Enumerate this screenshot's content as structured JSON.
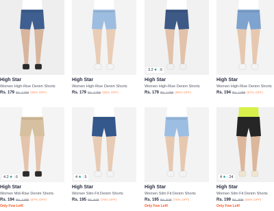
{
  "products": [
    {
      "brand": "High Star",
      "title": "Women High-Rise Denim Shorts",
      "price": "Rs. 179",
      "mrp": "Rs. 1799",
      "discount": "(90% OFF)",
      "rating": "",
      "rating_count": "",
      "stock": "",
      "skin": "#d8b59d",
      "shorts": "#3e5f8f",
      "shoe": "#2a2a2a",
      "bg": "#eeeeee"
    },
    {
      "brand": "High Star",
      "title": "Women High-Rise Denim Shorts",
      "price": "Rs. 179",
      "mrp": "Rs. 1799",
      "discount": "(90% OFF)",
      "rating": "",
      "rating_count": "",
      "stock": "",
      "skin": "#e9cdb6",
      "shorts": "#9dbde0",
      "shoe": "#f4f4f4",
      "bg": "#f3f3f3"
    },
    {
      "brand": "High Star",
      "title": "Women High-Rise Denim Shorts",
      "price": "Rs. 179",
      "mrp": "Rs. 1799",
      "discount": "(90% OFF)",
      "rating": "3.2",
      "rating_count": "6",
      "stock": "",
      "skin": "#e2c2aa",
      "shorts": "#3d5986",
      "shoe": "#f0f0f0",
      "bg": "#f1f1f1"
    },
    {
      "brand": "High Star",
      "title": "Women High-Rise Denim Shorts",
      "price": "Rs. 194",
      "mrp": "Rs. 1499",
      "discount": "(87% OFF)",
      "rating": "",
      "rating_count": "",
      "stock": "",
      "skin": "#e6c8b0",
      "shorts": "#7fa3cf",
      "shoe": "#f4f4f4",
      "bg": "#f3f3f3"
    },
    {
      "brand": "High Star",
      "title": "Women Mid-Rise Denim Shorts",
      "price": "Rs. 194",
      "mrp": "Rs. 1499",
      "discount": "(87% OFF)",
      "rating": "4.2",
      "rating_count": "6",
      "stock": "Only Few Left!",
      "skin": "#e4c4ac",
      "shorts": "#d6c09f",
      "shoe": "#2b2b2b",
      "bg": "#f4f4f4"
    },
    {
      "brand": "High Star",
      "title": "Women Slim Fit Denim Shorts",
      "price": "Rs. 195",
      "mrp": "Rs. 649",
      "discount": "(70% OFF)",
      "rating": "4",
      "rating_count": "5",
      "stock": "",
      "skin": "#e8cbb4",
      "shorts": "#35588c",
      "shoe": "#f4f4f4",
      "bg": "#f3f3f3"
    },
    {
      "brand": "High Star",
      "title": "Women Slim Fit Denim Shorts",
      "price": "Rs. 195",
      "mrp": "Rs. 649",
      "discount": "(70% OFF)",
      "rating": "",
      "rating_count": "",
      "stock": "Only Few Left!",
      "skin": "#e6c8b1",
      "shorts": "#9cbee2",
      "shoe": "#f4f4f4",
      "bg": "#f3f3f3"
    },
    {
      "brand": "High Star",
      "title": "Women Slim Fit Denim Shorts",
      "price": "Rs. 199",
      "mrp": "Rs. 999",
      "discount": "(80% OFF)",
      "rating": "4",
      "rating_count": "24",
      "stock": "Only Few Left!",
      "skin": "#dcb79c",
      "shorts": "#262626",
      "shoe": "#f0e6d0",
      "bg": "#f1f1f1",
      "top": "#d8f04a"
    }
  ],
  "colors": {
    "rating_star": "#14958f",
    "discount": "#ff905a",
    "few_left": "#ff5722"
  },
  "icons": {
    "rating": "star-icon"
  }
}
